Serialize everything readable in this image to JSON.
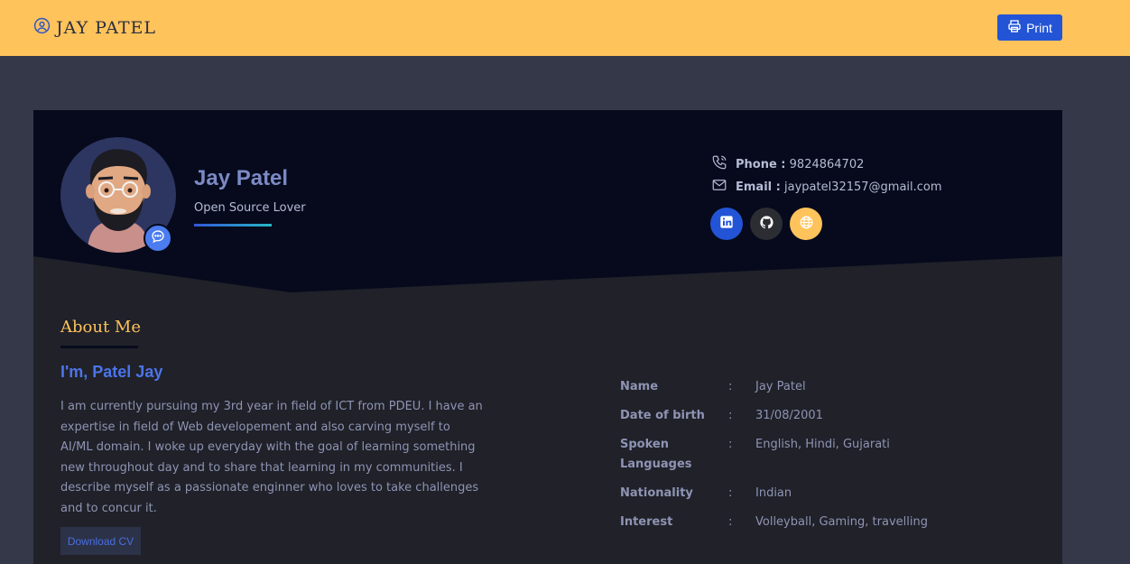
{
  "header": {
    "brand": "JAY PATEL",
    "print_label": "Print",
    "icons": {
      "brand": "user-circle-icon",
      "print": "printer-icon"
    }
  },
  "profile": {
    "name": "Jay Patel",
    "tagline": "Open Source Lover",
    "phone_label": "Phone :",
    "phone": "9824864702",
    "email_label": "Email :",
    "email": "jaypatel32157@gmail.com",
    "socials": [
      {
        "icon": "linkedin-icon",
        "color": "#2354d6"
      },
      {
        "icon": "github-icon",
        "color": "#2b2d33"
      },
      {
        "icon": "globe-icon",
        "color": "#ffc35b"
      }
    ]
  },
  "about": {
    "title": "About Me",
    "heading": "I'm, Patel Jay",
    "bio": "I am currently pursuing my 3rd year in field of ICT from PDEU. I have an expertise in field of Web developement and also carving myself to AI/ML domain. I woke up everyday with the goal of learning something new throughout day and to share that learning in my communities. I describe myself as a passionate enginner who loves to take challenges and to concur it.",
    "download_label": "Download CV"
  },
  "info": [
    {
      "label": "Name",
      "value": "Jay Patel"
    },
    {
      "label": "Date of birth",
      "value": "31/08/2001"
    },
    {
      "label": "Spoken Languages",
      "value": "English, Hindi, Gujarati"
    },
    {
      "label": "Nationality",
      "value": "Indian"
    },
    {
      "label": "Interest",
      "value": "Volleyball, Gaming, travelling"
    }
  ],
  "colors": {
    "topbar": "#ffc35b",
    "page_bg": "#343849",
    "card_bg": "#202129",
    "card_header": "#060a1c",
    "accent": "#2354d6",
    "heading_gold": "#ffc35b"
  }
}
